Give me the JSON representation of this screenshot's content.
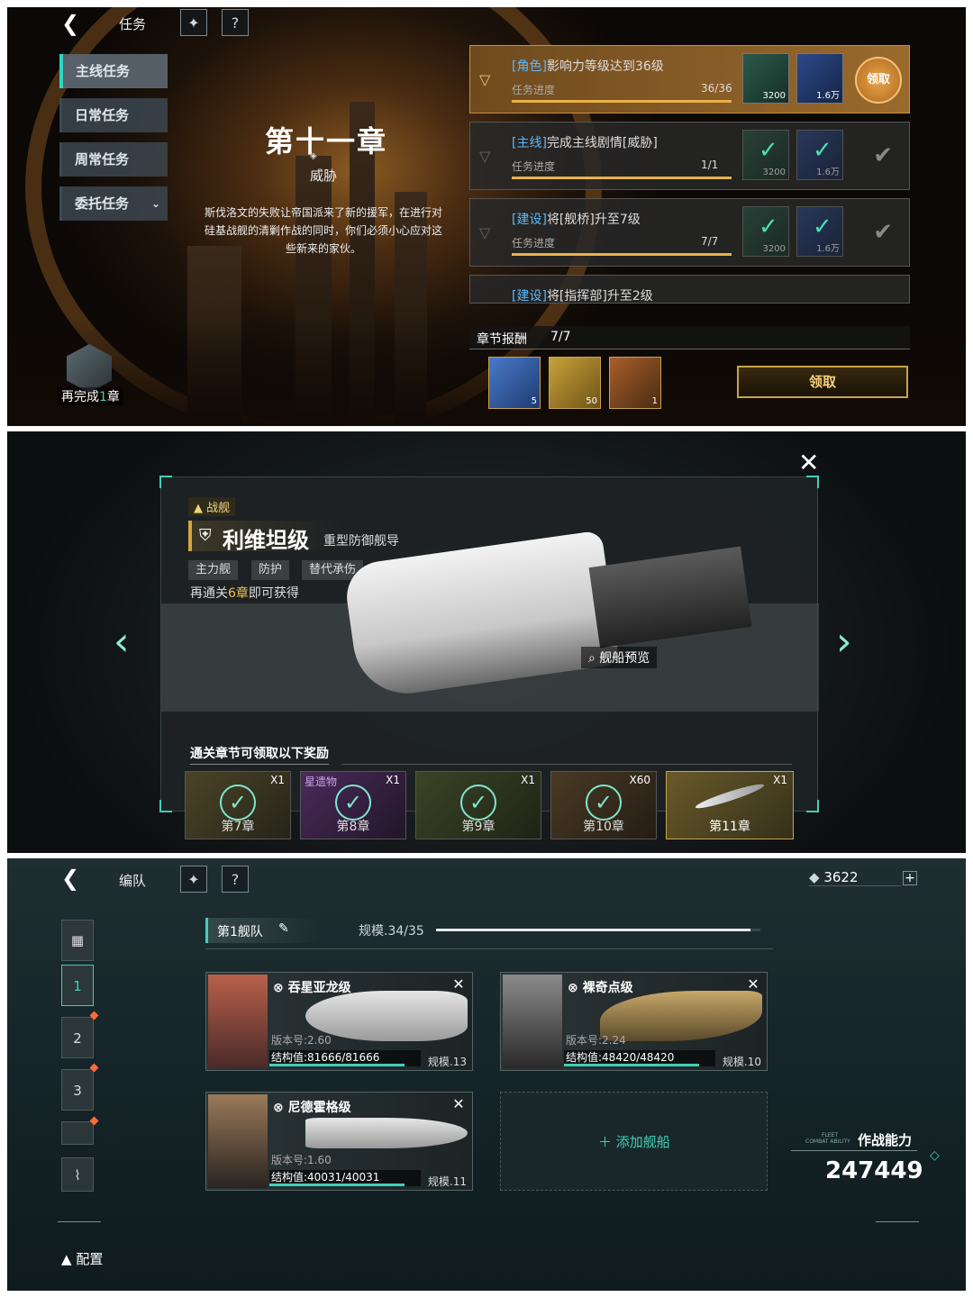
{
  "tasks_screen": {
    "title": "任务",
    "tabs": [
      {
        "label": "主线任务",
        "active": true
      },
      {
        "label": "日常任务",
        "active": false
      },
      {
        "label": "周常任务",
        "active": false
      },
      {
        "label": "委托任务",
        "active": false
      }
    ],
    "chapter": {
      "title": "第十一章",
      "subtitle": "威胁",
      "description": "斯伐洛文的失败让帝国派来了新的援军，在进行对硅基战舰的清剿作战的同时，你们必须小心应对这些新来的家伙。"
    },
    "remaining_label_pre": "再完成",
    "remaining_count": "1",
    "remaining_label_post": "章",
    "tasks": [
      {
        "tag": "[角色]",
        "text": "影响力等级达到36级",
        "progress_label": "任务进度",
        "progress": "36/36",
        "reward1": "3200",
        "reward2": "1.6万",
        "action": "领取",
        "state": "claimable"
      },
      {
        "tag": "[主线]",
        "text": "完成主线剧情[威胁]",
        "progress_label": "任务进度",
        "progress": "1/1",
        "reward1": "3200",
        "reward2": "1.6万",
        "state": "done"
      },
      {
        "tag": "[建设]",
        "text": "将[舰桥]升至7级",
        "progress_label": "任务进度",
        "progress": "7/7",
        "reward1": "3200",
        "reward2": "1.6万",
        "state": "done"
      },
      {
        "tag": "[建设]",
        "text": "将[指挥部]升至2级",
        "state": "partial"
      }
    ],
    "chapter_reward": {
      "label": "章节报酬",
      "count": "7/7",
      "items": [
        "5",
        "50",
        "1"
      ],
      "claim": "领取"
    }
  },
  "ship_preview": {
    "type_badge": "战舰",
    "name": "利维坦级",
    "class": "重型防御舰导",
    "chips": [
      "主力舰",
      "防护",
      "替代承伤"
    ],
    "unlock_pre": "再通关",
    "unlock_num": "6章",
    "unlock_post": "即可获得",
    "preview_button": "舰船预览",
    "rewards_title": "通关章节可领取以下奖励",
    "rewards": [
      {
        "label": "第7章",
        "qty": "X1",
        "claimed": true
      },
      {
        "label": "第8章",
        "qty": "X1",
        "claimed": true,
        "top": "星遗物"
      },
      {
        "label": "第9章",
        "qty": "X1",
        "claimed": true
      },
      {
        "label": "第10章",
        "qty": "X60",
        "claimed": true
      },
      {
        "label": "第11章",
        "qty": "X1",
        "claimed": false
      }
    ]
  },
  "fleet_screen": {
    "title": "编队",
    "currency": "3622",
    "fleet_name": "第1舰队",
    "scale_label": "规模.34/35",
    "scale_fraction": 0.97,
    "slots": [
      "1",
      "2",
      "3"
    ],
    "ships": [
      {
        "name": "吞星亚龙级",
        "version": "版本号:2.60",
        "hp": "结构值:81666/81666",
        "scale": "规模.13"
      },
      {
        "name": "裸奇点级",
        "version": "版本号:2.24",
        "hp": "结构值:48420/48420",
        "scale": "规模.10"
      },
      {
        "name": "尼德霍格级",
        "version": "版本号:1.60",
        "hp": "结构值:40031/40031",
        "scale": "规模.11"
      }
    ],
    "add_ship": "添加舰船",
    "power_label": "作战能力",
    "power_value": "247449",
    "power_sub1": "FLEET",
    "power_sub2": "COMBAT ABILITY",
    "config_label": "配置"
  },
  "colors": {
    "accent": "#2fd6c6",
    "gold": "#e9b24a",
    "tag_blue": "#5ab8ff"
  }
}
